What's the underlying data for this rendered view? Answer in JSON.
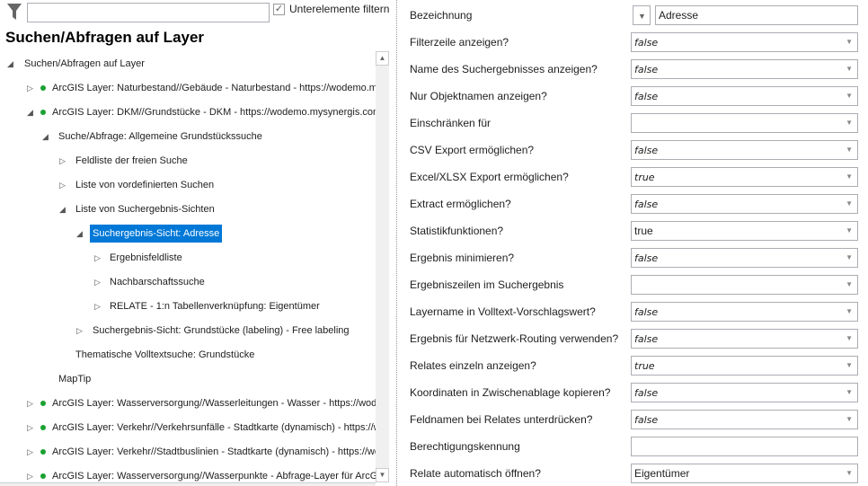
{
  "toolbar": {
    "filter_icon": "funnel-icon",
    "filter_value": "",
    "subfilter_label": "Unterelemente filtern",
    "subfilter_checked": true
  },
  "title": "Suchen/Abfragen auf Layer",
  "tree": [
    {
      "label": "Suchen/Abfragen auf Layer",
      "level": 0,
      "toggle": "expanded",
      "dot": false
    },
    {
      "label": "ArcGIS Layer: Naturbestand//Gebäude - Naturbestand - https://wodemo.mysynergis.com",
      "level": 1,
      "toggle": "collapsed",
      "dot": true
    },
    {
      "label": "ArcGIS Layer: DKM//Grundstücke - DKM - https://wodemo.mysynergis.com",
      "level": 1,
      "toggle": "expanded",
      "dot": true
    },
    {
      "label": "Suche/Abfrage: Allgemeine Grundstückssuche",
      "level": 2,
      "toggle": "expanded",
      "dot": false
    },
    {
      "label": "Feldliste der freien Suche",
      "level": 3,
      "toggle": "collapsed",
      "dot": false
    },
    {
      "label": "Liste von vordefinierten Suchen",
      "level": 3,
      "toggle": "collapsed",
      "dot": false
    },
    {
      "label": "Liste von Suchergebnis-Sichten",
      "level": 3,
      "toggle": "expanded",
      "dot": false
    },
    {
      "label": "Suchergebnis-Sicht: Adresse",
      "level": 4,
      "toggle": "expanded",
      "dot": false,
      "selected": true
    },
    {
      "label": "Ergebnisfeldliste",
      "level": 5,
      "toggle": "collapsed",
      "dot": false
    },
    {
      "label": "Nachbarschaftssuche",
      "level": 5,
      "toggle": "collapsed",
      "dot": false
    },
    {
      "label": "RELATE - 1:n Tabellenverknüpfung: Eigentümer",
      "level": 5,
      "toggle": "collapsed",
      "dot": false
    },
    {
      "label": "Suchergebnis-Sicht: Grundstücke (labeling) - Free labeling",
      "level": 4,
      "toggle": "collapsed",
      "dot": false
    },
    {
      "label": "Thematische Volltextsuche: Grundstücke",
      "level": 3,
      "toggle": "none",
      "dot": false
    },
    {
      "label": "MapTip",
      "level": 2,
      "toggle": "none",
      "dot": false
    },
    {
      "label": "ArcGIS Layer: Wasserversorgung//Wasserleitungen - Wasser - https://wodemo",
      "level": 1,
      "toggle": "collapsed",
      "dot": true
    },
    {
      "label": "ArcGIS Layer: Verkehr//Verkehrsunfälle - Stadtkarte (dynamisch) - https://wodemo",
      "level": 1,
      "toggle": "collapsed",
      "dot": true
    },
    {
      "label": "ArcGIS Layer: Verkehr//Stadtbuslinien - Stadtkarte (dynamisch) - https://wodemo",
      "level": 1,
      "toggle": "collapsed",
      "dot": true
    },
    {
      "label": "ArcGIS Layer: Wasserversorgung//Wasserpunkte - Abfrage-Layer für ArcGIS",
      "level": 1,
      "toggle": "collapsed",
      "dot": true
    }
  ],
  "properties": [
    {
      "label": "Bezeichnung",
      "value": "Adresse",
      "type": "text-dropdown"
    },
    {
      "label": "Filterzeile anzeigen?",
      "value": "false",
      "italic": true
    },
    {
      "label": "Name des Suchergebnisses anzeigen?",
      "value": "false",
      "italic": true
    },
    {
      "label": "Nur Objektnamen anzeigen?",
      "value": "false",
      "italic": true
    },
    {
      "label": "Einschränken für",
      "value": ""
    },
    {
      "label": "CSV Export ermöglichen?",
      "value": "false",
      "italic": true
    },
    {
      "label": "Excel/XLSX Export ermöglichen?",
      "value": "true",
      "italic": true
    },
    {
      "label": "Extract ermöglichen?",
      "value": "false",
      "italic": true
    },
    {
      "label": "Statistikfunktionen?",
      "value": "true",
      "italic": false
    },
    {
      "label": "Ergebnis minimieren?",
      "value": "false",
      "italic": true
    },
    {
      "label": "Ergebniszeilen im Suchergebnis",
      "value": ""
    },
    {
      "label": "Layername in Volltext-Vorschlagswert?",
      "value": "false",
      "italic": true
    },
    {
      "label": "Ergebnis für Netzwerk-Routing verwenden?",
      "value": "false",
      "italic": true
    },
    {
      "label": "Relates einzeln anzeigen?",
      "value": "true",
      "italic": true
    },
    {
      "label": "Koordinaten in Zwischenablage kopieren?",
      "value": "false",
      "italic": true
    },
    {
      "label": "Feldnamen bei Relates unterdrücken?",
      "value": "false",
      "italic": true
    },
    {
      "label": "Berechtigungskennung",
      "value": "",
      "type": "text"
    },
    {
      "label": "Relate automatisch öffnen?",
      "value": "Eigentümer",
      "italic": false
    }
  ],
  "colors": {
    "selection": "#0078d7",
    "status_dot": "#1aa131"
  }
}
